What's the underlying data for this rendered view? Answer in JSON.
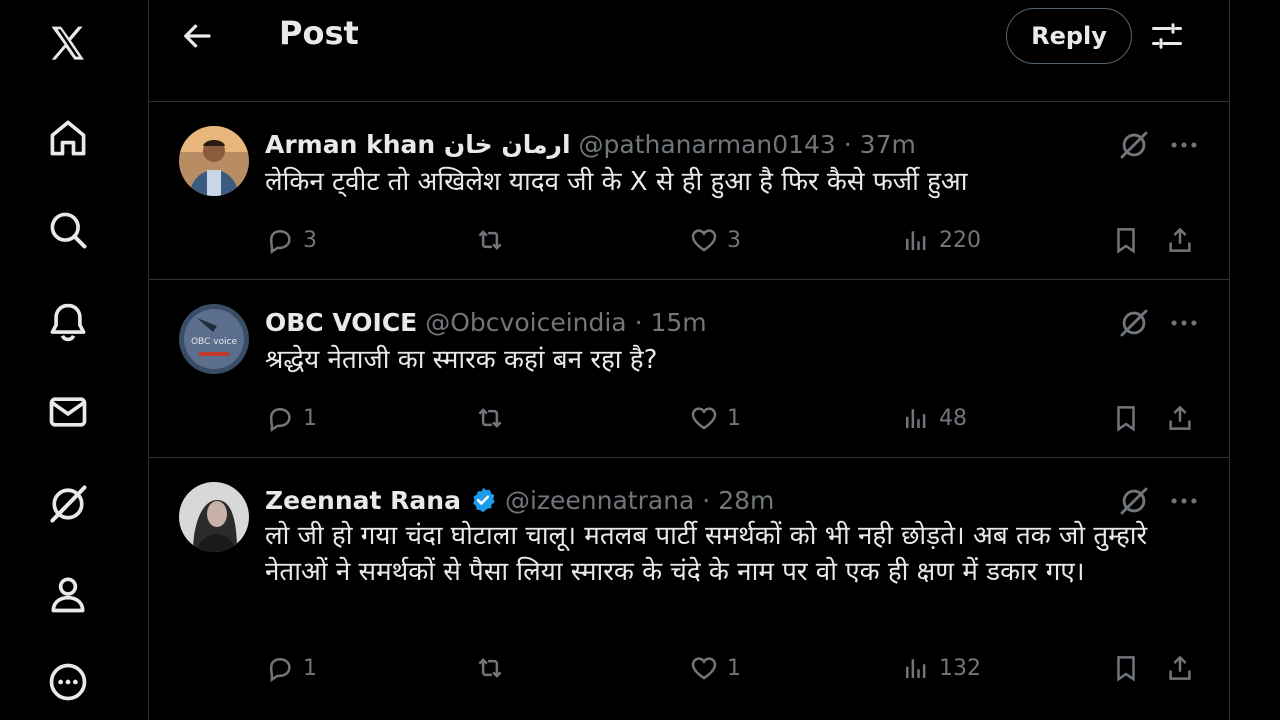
{
  "sidebar": {
    "icons": [
      "x-logo-icon",
      "home-icon",
      "search-icon",
      "notifications-icon",
      "messages-icon",
      "grok-icon",
      "profile-icon",
      "more-icon"
    ]
  },
  "header": {
    "title": "Post",
    "reply_label": "Reply"
  },
  "posts": [
    {
      "name": "Arman khan ارمان خان",
      "handle": "@pathanarman0143 · 37m",
      "verified": false,
      "text": "लेकिन ट्वीट तो अखिलेश यादव जी के X से ही हुआ है फिर कैसे फर्जी हुआ",
      "replies": "3",
      "reposts": "",
      "likes": "3",
      "views": "220"
    },
    {
      "name": "OBC VOICE",
      "handle": "@Obcvoiceindia · 15m",
      "verified": false,
      "text": "श्रद्धेय नेताजी का स्मारक कहां बन रहा है?",
      "replies": "1",
      "reposts": "",
      "likes": "1",
      "views": "48"
    },
    {
      "name": "Zeennat Rana",
      "handle": "@izeennatrana · 28m",
      "verified": true,
      "text": "लो जी हो गया चंदा घोटाला चालू। मतलब पार्टी समर्थकों को भी नही छोड़ते। अब तक जो तुम्हारे नेताओं ने समर्थकों से पैसा लिया स्मारक के चंदे के नाम पर वो एक ही क्षण में डकार गए।",
      "replies": "1",
      "reposts": "",
      "likes": "1",
      "views": "132"
    }
  ],
  "colors": {
    "background": "#000000",
    "text": "#e7e9ea",
    "muted": "#71767b",
    "border": "#2f3336",
    "verified": "#1d9bf0"
  }
}
